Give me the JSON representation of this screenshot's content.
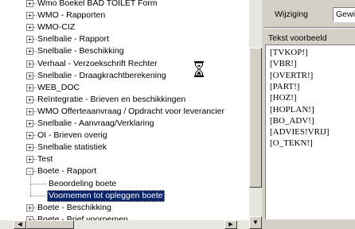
{
  "tree": {
    "items": [
      {
        "label": "Wmo Boekel BAD TOILET Form",
        "level": 0,
        "expander": "+"
      },
      {
        "label": "WMO - Rapporten",
        "level": 0,
        "expander": "+"
      },
      {
        "label": "WMO-CIZ",
        "level": 0,
        "expander": "+"
      },
      {
        "label": "Snelbalie - Rapport",
        "level": 0,
        "expander": "+"
      },
      {
        "label": "Snelbalie - Beschikking",
        "level": 0,
        "expander": "+"
      },
      {
        "label": "Verhaal - Verzoekschrift Rechter",
        "level": 0,
        "expander": "+"
      },
      {
        "label": "Snelbalie - Draagkrachtberekening",
        "level": 0,
        "expander": "+"
      },
      {
        "label": "WEB_DOC",
        "level": 0,
        "expander": "+"
      },
      {
        "label": "Reïntegratie - Brieven en beschikkingen",
        "level": 0,
        "expander": "+"
      },
      {
        "label": "WMO Offerteaanvraag / Opdracht voor leverancier",
        "level": 0,
        "expander": "+"
      },
      {
        "label": "Snelbalie - Aanvraag/Verklaring",
        "level": 0,
        "expander": "+"
      },
      {
        "label": "OI - Brieven overig",
        "level": 0,
        "expander": "+"
      },
      {
        "label": "Snelbalie statistiek",
        "level": 0,
        "expander": "+"
      },
      {
        "label": "Test",
        "level": 0,
        "expander": "+"
      },
      {
        "label": "Boete - Rapport",
        "level": 0,
        "expander": "-"
      },
      {
        "label": "Beoordeling boete",
        "level": 1,
        "expander": ""
      },
      {
        "label": "Voornemen tot opleggen boete",
        "level": 1,
        "expander": "",
        "selected": true
      },
      {
        "label": "Boete - Beschikking",
        "level": 0,
        "expander": "+"
      },
      {
        "label": "Boete - Brief voornemen",
        "level": 0,
        "expander": "+"
      }
    ]
  },
  "right": {
    "wijziging_label": "Wijziging",
    "wijziging_value": "Gewi",
    "tekst_voorbeeld_label": "Tekst voorbeeld",
    "tekst_lines": [
      "[TVKOP!]",
      "[VBR!]",
      "[OVERTR!]",
      "[PART!]",
      "[HOZ!]",
      "[HOPLAN!]",
      "[BO_ADV!]",
      "[ADVIES!VRIJ]",
      "[O_TEKN!]"
    ]
  },
  "icons": {
    "busy": "hourglass-icon",
    "scroll_down": "arrow-down-icon",
    "scroll_left": "arrow-left-icon",
    "scroll_right": "arrow-right-icon"
  },
  "colors": {
    "selection": "#0a246a",
    "panel": "#d4d0c8"
  }
}
